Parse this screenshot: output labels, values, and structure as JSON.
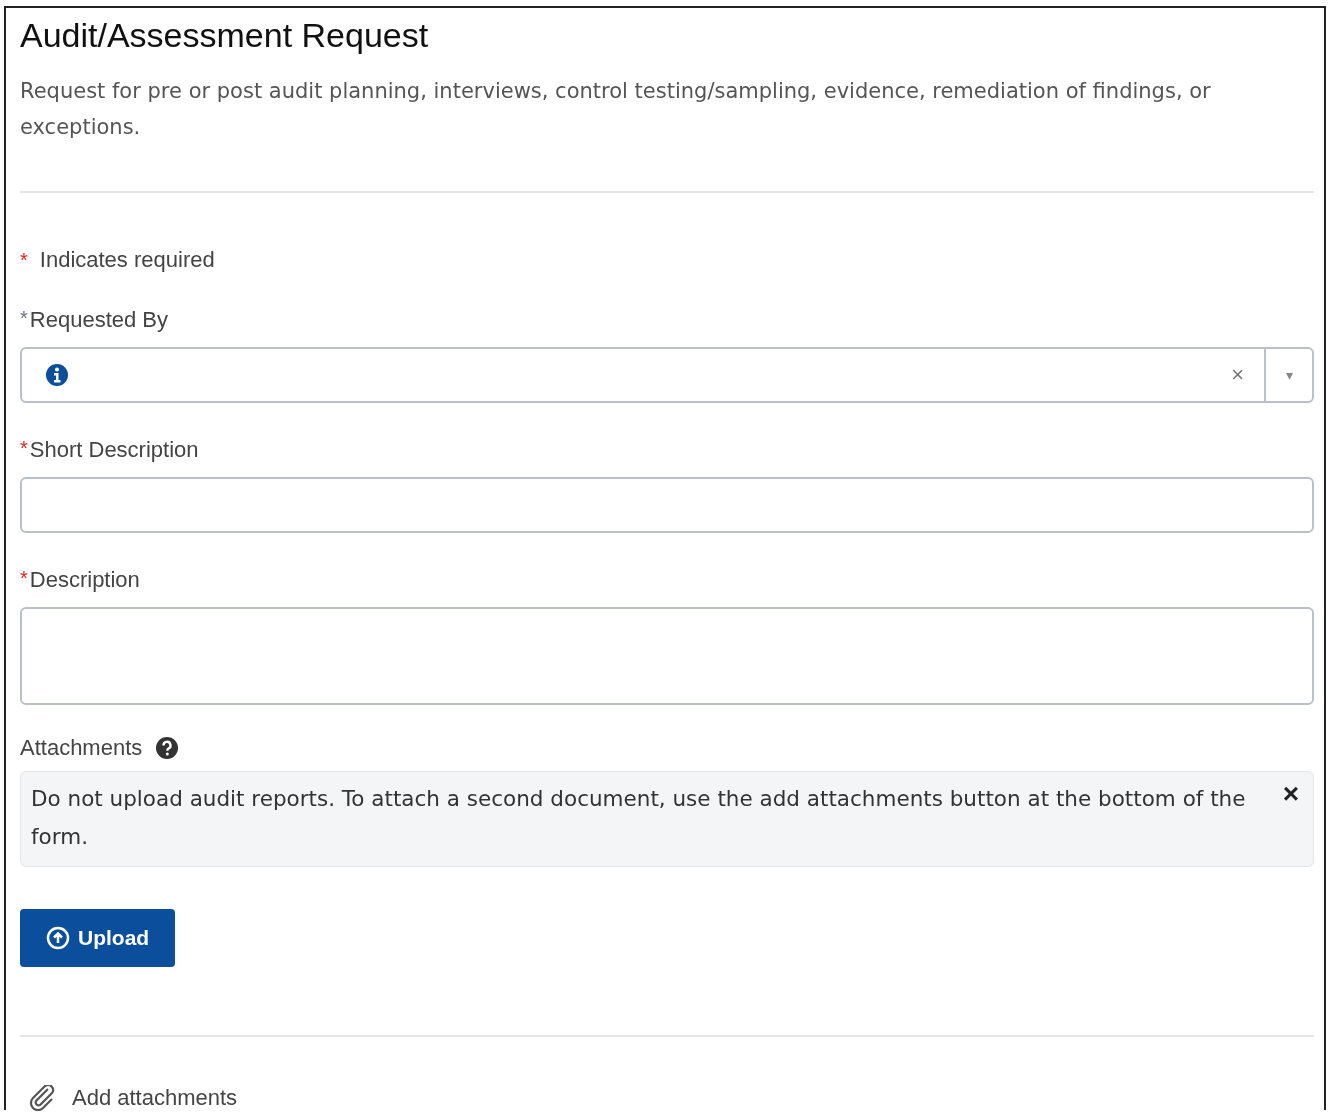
{
  "title": "Audit/Assessment Request",
  "description": "Request for pre or post audit planning, interviews, control testing/sampling, evidence, remediation of findings, or exceptions.",
  "required_note": {
    "mark": "*",
    "text": "Indicates required"
  },
  "fields": [
    {
      "kind": "lookup",
      "asterisk": "*",
      "color": "#6b7280",
      "label": "Requested By",
      "clear": "×",
      "caret": "▾"
    },
    {
      "kind": "text",
      "asterisk": "*",
      "color": "#e02424",
      "label": "Short Description"
    },
    {
      "kind": "textarea",
      "asterisk": "*",
      "color": "#e02424",
      "label": "Description"
    }
  ],
  "attachments": {
    "label": "Attachments",
    "notice": "Do not upload audit reports. To attach a second document, use the add attachments button at the bottom of the form.",
    "dismiss": "×",
    "upload_button": "Upload"
  },
  "footer_link": "Add attachments"
}
